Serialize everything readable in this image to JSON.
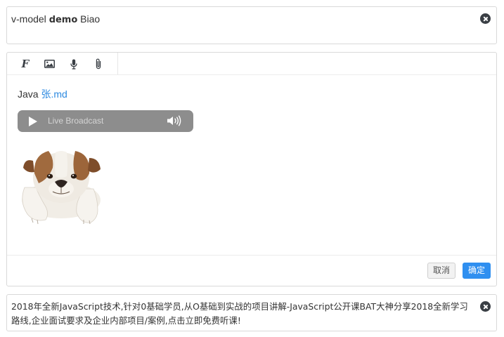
{
  "top_input": {
    "value_prefix": "v-model ",
    "value_bold": "demo",
    "value_suffix": " Biao",
    "clear_icon": "close-circle-icon"
  },
  "editor": {
    "toolbar": [
      {
        "icon": "font-icon",
        "glyph": "F"
      },
      {
        "icon": "image-icon"
      },
      {
        "icon": "microphone-icon"
      },
      {
        "icon": "paperclip-icon"
      }
    ],
    "content": {
      "java_text": "Java ",
      "link_text": "张.md",
      "audio": {
        "label": "Live Broadcast",
        "play_icon": "play-icon",
        "volume_icon": "volume-icon"
      },
      "image": "bulldog-puppy-image"
    },
    "footer": {
      "cancel_label": "取消",
      "ok_label": "确定"
    }
  },
  "bottom_input": {
    "value": "2018年全新JavaScript技术,针对0基础学员,从O基础到实战的项目讲解-JavaScript公开课BAT大神分享2018全新学习路线,企业面试要求及企业内部项目/案例,点击立即免费听课!",
    "clear_icon": "close-circle-icon"
  },
  "colors": {
    "link": "#2d8ae0",
    "primary_button": "#2f8ff0",
    "audio_bar": "#8d8d8d",
    "icon": "#3a3f45"
  }
}
